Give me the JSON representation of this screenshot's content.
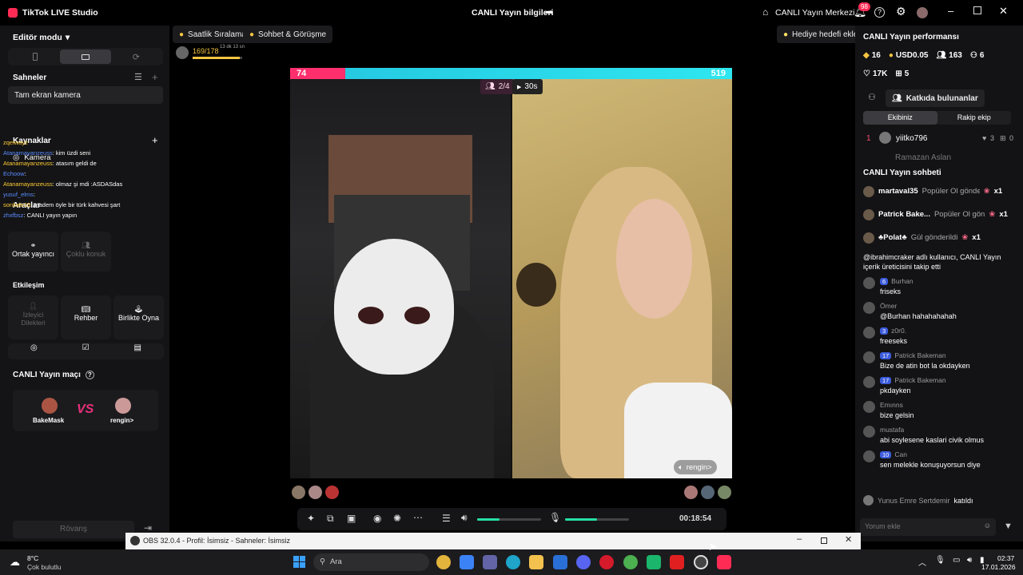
{
  "app": {
    "title": "TikTok LIVE Studio",
    "center_title": "CANLI Yayın bilgileri",
    "live_center": "CANLI Yayın Merkezi",
    "notif_count": "98"
  },
  "left": {
    "editor_mode": "Editör modu",
    "scenes_label": "Sahneler",
    "scene_item": "Tam ekran kamera",
    "sources_label": "Kaynaklar",
    "source_item": "Kamera",
    "tools_label": "Araçlar",
    "tool_cohost": "Ortak yayıncı",
    "tool_multi": "Çoklu konuk",
    "interaction_label": "Etkileşim",
    "tool_viewer_req": "İzleyici Dilekleri",
    "tool_guide": "Rehber",
    "tool_play": "Birlikte Oyna",
    "match_label": "CANLI Yayın maçı",
    "player1": "BakeMask",
    "player2": "rengin>",
    "vs": "VS",
    "rematch": "Rövanş",
    "overlay_chat": [
      {
        "user": "zqelwayz",
        "text": ""
      },
      {
        "user": "Atanamayanzeuss",
        "text": ": kim üzdi seni"
      },
      {
        "user": "Atanamayanzeuss",
        "text": ": atasım geldi de"
      },
      {
        "user": "Echoow",
        "text": ":"
      },
      {
        "user": "Atanamayanzeuss",
        "text": ": olmaz şi mdi :ASDASdas"
      },
      {
        "user": "yusuf_elms",
        "text": ":"
      },
      {
        "user": "sonkale16",
        "text": ": madem öyle bir türk kahvesi şart"
      },
      {
        "user": "zhxfbsz",
        "text": ": CANLI yayın yapın"
      }
    ]
  },
  "top": {
    "chip1": "Saatlik Sıralama",
    "chip2": "Sohbet & Görüşme",
    "progress": "169/178",
    "progress_time": "13 dk 13 sn",
    "gift_goal": "Hediye hedefi ekle"
  },
  "battle": {
    "score_left": "74",
    "score_right": "519",
    "score_left_share": 0.125,
    "guests": "2/4",
    "timer": "30s",
    "right_name": "rengin>",
    "elapsed": "00:18:54",
    "volume_speaker": 0.35,
    "volume_mic": 0.5
  },
  "right": {
    "perf_title": "CANLI Yayın performansı",
    "stats": [
      {
        "icon": "gem-icon",
        "value": "16"
      },
      {
        "icon": "coin-icon",
        "value": "USD0.05"
      },
      {
        "icon": "users-icon",
        "value": "163"
      },
      {
        "icon": "user-plus-icon",
        "value": "6"
      },
      {
        "icon": "heart-icon",
        "value": "17K"
      },
      {
        "icon": "gift-icon",
        "value": "5"
      }
    ],
    "contributors_btn": "Katkıda bulunanlar",
    "tab_team": "Ekibiniz",
    "tab_rival": "Rakip ekip",
    "rank1_name": "yiitko796",
    "rank1_num": "1",
    "rank1_a": "3",
    "rank1_b": "0",
    "rank2_name": "Ramazan Aslan",
    "chat_title": "CANLI Yayın sohbeti",
    "gifts": [
      {
        "user": "martaval35",
        "text": "Popüler Ol gönde",
        "count": "x1"
      },
      {
        "user": "Patrick Bake...",
        "text": "Popüler Ol gön",
        "count": "x1"
      },
      {
        "user": "♣Polat♣",
        "text": "Gül gönderildi",
        "count": "x1"
      }
    ],
    "messages": [
      {
        "user": "",
        "badge": "",
        "text": "@ibrahimcraker adlı kullanıcı, CANLI Yayın içerik üreticisini takip etti"
      },
      {
        "user": "Burhan",
        "badge": "6",
        "text": "friseks"
      },
      {
        "user": "Ömer",
        "badge": "",
        "text": "@Burhan hahahahahah"
      },
      {
        "user": "z0r0.",
        "badge": "3",
        "text": "freeseks"
      },
      {
        "user": "Patrick Bakeman",
        "badge": "17",
        "text": "Bize de atin bot la okdayken"
      },
      {
        "user": "Patrick Bakeman",
        "badge": "17",
        "text": "pkdayken"
      },
      {
        "user": "Emınns",
        "badge": "",
        "text": "bize gelsin"
      },
      {
        "user": "mustafa",
        "badge": "",
        "text": "abi soylesene kaslari civik olmus"
      },
      {
        "user": "Can",
        "badge": "10",
        "text": "sen melekle konuşuyorsun diye"
      }
    ],
    "joined_user": "Yunus Emre Sertdemir",
    "joined_text": "katıldı",
    "chat_placeholder": "Yorum ekle"
  },
  "obs": {
    "title": "OBS 32.0.4 - Profil: İsimsiz - Sahneler: İsimsiz"
  },
  "taskbar": {
    "temp": "8°C",
    "weather": "Çok bulutlu",
    "search": "Ara",
    "time": "02:37",
    "date": "17.01.2026"
  }
}
